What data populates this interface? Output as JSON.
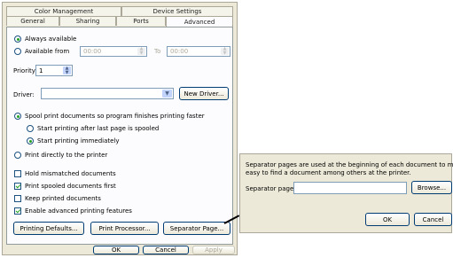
{
  "tabs": {
    "row1": [
      "Color Management",
      "Device Settings"
    ],
    "row2": [
      "General",
      "Sharing",
      "Ports",
      "Advanced"
    ]
  },
  "availability": {
    "always_label": "Always available",
    "from_label": "Available from",
    "from_time": "00:00",
    "to_label": "To",
    "to_time": "00:00"
  },
  "priority": {
    "label": "Priority:",
    "value": "1"
  },
  "driver": {
    "label": "Driver:",
    "value": "",
    "new_driver_button": "New Driver..."
  },
  "spool": {
    "spool_label": "Spool print documents so program finishes printing faster",
    "after_last_label": "Start printing after last page is spooled",
    "immediately_label": "Start printing immediately",
    "direct_label": "Print directly to the printer"
  },
  "options": {
    "hold_mismatched": "Hold mismatched documents",
    "spooled_first": "Print spooled documents first",
    "keep_printed": "Keep printed documents",
    "advanced_features": "Enable advanced printing features"
  },
  "buttons": {
    "printing_defaults": "Printing Defaults...",
    "print_processor": "Print Processor...",
    "separator_page": "Separator Page..."
  },
  "footer": {
    "ok": "OK",
    "cancel": "Cancel",
    "apply": "Apply"
  },
  "separator_dialog": {
    "description_line1": "Separator pages are used at the beginning of each document to make it",
    "description_line2": "easy to find a document among others at the printer.",
    "page_label": "Separator page:",
    "page_value": "",
    "browse": "Browse...",
    "ok": "OK",
    "cancel": "Cancel"
  },
  "icons": {
    "spin": "spin-arrows-icon",
    "dropdown": "chevron-down-icon"
  }
}
